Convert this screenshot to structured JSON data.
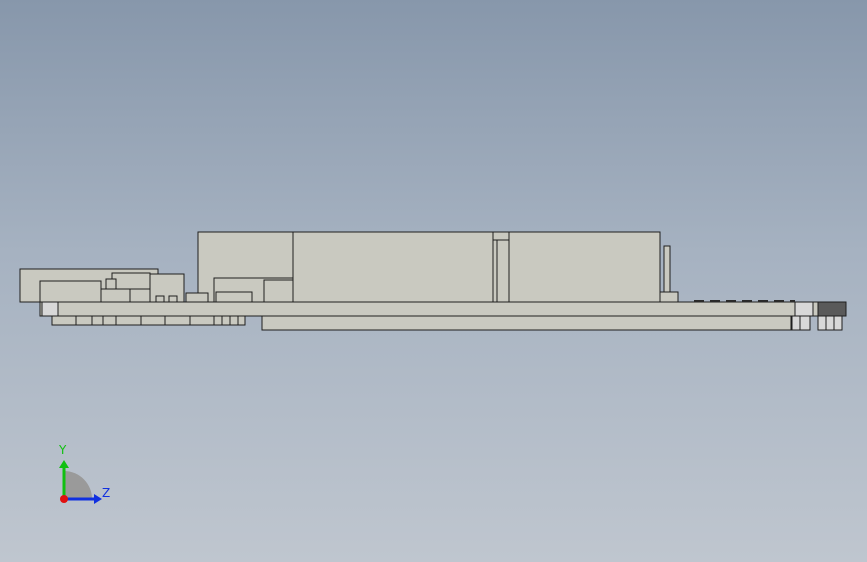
{
  "view": {
    "background_top": "#8797ab",
    "background_bottom": "#bfc6cf",
    "body_fill": "#c9c9c0",
    "edge_color": "#1e1e1e",
    "standoff_fill": "#d8d8d8"
  },
  "triad": {
    "y_label": "Y",
    "z_label": "Z",
    "x_color": "#e01010",
    "y_color": "#10c010",
    "z_color": "#1030e0"
  }
}
